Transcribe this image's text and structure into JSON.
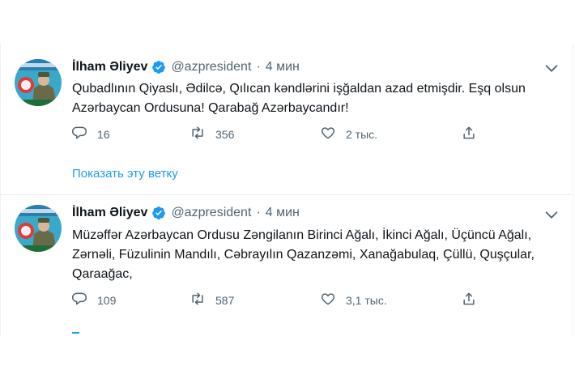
{
  "tweets": [
    {
      "author": "İlham Əliyev",
      "handle": "@azpresident",
      "separator": "·",
      "time": "4 мин",
      "text": "Qubadlının Qiyaslı, Ədilcə, Qılıcan kəndlərini işğaldan azad etmişdir. Eşq olsun Azərbaycan Ordusuna! Qarabağ Azərbaycandır!",
      "replies": "16",
      "retweets": "356",
      "likes": "2 тыс.",
      "show_thread": "Показать эту ветку"
    },
    {
      "author": "İlham Əliyev",
      "handle": "@azpresident",
      "separator": "·",
      "time": "4 мин",
      "text": "Müzəffər Azərbaycan Ordusu Zəngilanın Birinci Ağalı, İkinci Ağalı, Üçüncü Ağalı, Zərnəli, Füzulinin Mandılı, Cəbrayılın Qazanzəmi, Xanağabulaq, Çüllü, Quşçular, Qaraağac,",
      "replies": "109",
      "retweets": "587",
      "likes": "3,1 тыс."
    }
  ],
  "colors": {
    "link": "#1d9bf0",
    "muted": "#536471",
    "verified": "#1d9bf0"
  }
}
